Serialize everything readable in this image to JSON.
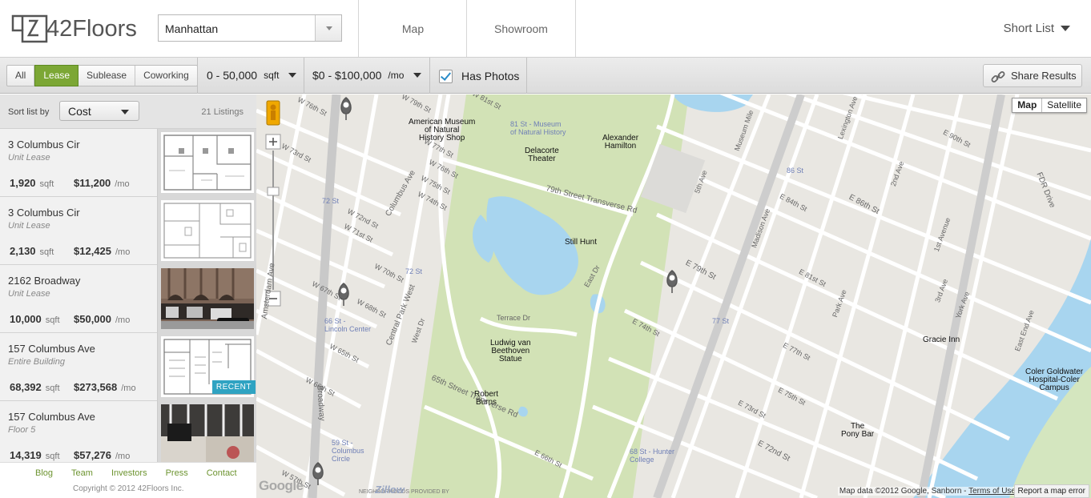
{
  "header": {
    "logo": "42Floors",
    "location_value": "Manhattan",
    "tabs": [
      {
        "label": "Map"
      },
      {
        "label": "Showroom"
      }
    ],
    "short_list_label": "Short List"
  },
  "filters": {
    "type_options": [
      {
        "label": "All"
      },
      {
        "label": "Lease",
        "active": true
      },
      {
        "label": "Sublease"
      },
      {
        "label": "Coworking"
      }
    ],
    "size_value": "0 - 50,000",
    "size_unit": "sqft",
    "price_value": "$0 - $100,000",
    "price_unit": "/mo",
    "has_photos_checked": true,
    "has_photos_label": "Has Photos",
    "share_label": "Share Results"
  },
  "sidebar": {
    "sort_label": "Sort list by",
    "sort_value": "Cost",
    "count_label": "21 Listings",
    "listings": [
      {
        "address": "3 Columbus Cir",
        "type": "Unit Lease",
        "sqft": "1,920",
        "sqft_unit": "sqft",
        "price": "$11,200",
        "price_unit": "/mo",
        "thumb": "floorplan"
      },
      {
        "address": "3 Columbus Cir",
        "type": "Unit Lease",
        "sqft": "2,130",
        "sqft_unit": "sqft",
        "price": "$12,425",
        "price_unit": "/mo",
        "thumb": "floorplan"
      },
      {
        "address": "2162 Broadway",
        "type": "Unit Lease",
        "sqft": "10,000",
        "sqft_unit": "sqft",
        "price": "$50,000",
        "price_unit": "/mo",
        "thumb": "photo-building"
      },
      {
        "address": "157 Columbus Ave",
        "type": "Entire Building",
        "sqft": "68,392",
        "sqft_unit": "sqft",
        "price": "$273,568",
        "price_unit": "/mo",
        "thumb": "floorplan",
        "badge": "RECENT"
      },
      {
        "address": "157 Columbus Ave",
        "type": "Floor 5",
        "sqft": "14,319",
        "sqft_unit": "sqft",
        "price": "$57,276",
        "price_unit": "/mo",
        "thumb": "photo-office"
      }
    ],
    "footer_links": [
      {
        "label": "Blog"
      },
      {
        "label": "Team"
      },
      {
        "label": "Investors"
      },
      {
        "label": "Press"
      },
      {
        "label": "Contact"
      }
    ],
    "copyright": "Copyright © 2012 42Floors Inc."
  },
  "map": {
    "type_buttons": [
      {
        "label": "Map",
        "active": true
      },
      {
        "label": "Satellite"
      }
    ],
    "attribution": "Map data ©2012 Google, Sanborn - ",
    "terms": "Terms of Use",
    "report": "Report a map error",
    "google_logo": "Google",
    "zillow_credit": "NEIGHBORHOODS PROVIDED BY",
    "zillow_logo": "Zillow",
    "places": [
      {
        "label": "American Museum\nof Natural\nHistory Shop"
      },
      {
        "label": "81 St - Museum\nof Natural History"
      },
      {
        "label": "Delacorte\nTheater"
      },
      {
        "label": "Alexander\nHamilton"
      },
      {
        "label": "Still Hunt"
      },
      {
        "label": "Ludwig van\nBeethoven\nStatue"
      },
      {
        "label": "Robert\nBurns"
      },
      {
        "label": "72 St"
      },
      {
        "label": "72 St"
      },
      {
        "label": "66 St -\nLincoln Center"
      },
      {
        "label": "59 St -\nColumbus\nCircle"
      },
      {
        "label": "68 St - Hunter\nCollege"
      },
      {
        "label": "77 St"
      },
      {
        "label": "86 St"
      },
      {
        "label": "Gracie Inn"
      },
      {
        "label": "The\nPony Bar"
      },
      {
        "label": "Coler Goldwater\nHospital-Coler\nCampus"
      }
    ],
    "streets": [
      "W 76th St",
      "W 79th St",
      "W 81st St",
      "W 73rd St",
      "W 72nd St",
      "W 71st St",
      "W 70th St",
      "W 68th St",
      "W 67th St",
      "W 65th St",
      "W 57th St",
      "W 77th St",
      "W 75th St",
      "W 74th St",
      "W 76th St",
      "W 66th St",
      "Columbus Ave",
      "Central Park West",
      "Broadway",
      "Amsterdam Ave",
      "79th Street Transverse Rd",
      "65th Street Transverse Rd",
      "Terrace Dr",
      "East Dr",
      "West Dr",
      "5th Ave",
      "Madison Ave",
      "Park Ave",
      "Lexington Ave",
      "3rd Ave",
      "2nd Ave",
      "1st Avenue",
      "York Ave",
      "East End Ave",
      "FDR Drive",
      "Museum Mile",
      "E 79th St",
      "E 86th St",
      "E 72nd St",
      "E 66th St",
      "E 74th St",
      "E 90th St",
      "E 84th St",
      "E 81st St",
      "E 77th St",
      "E 75th St",
      "E 73rd St"
    ]
  }
}
